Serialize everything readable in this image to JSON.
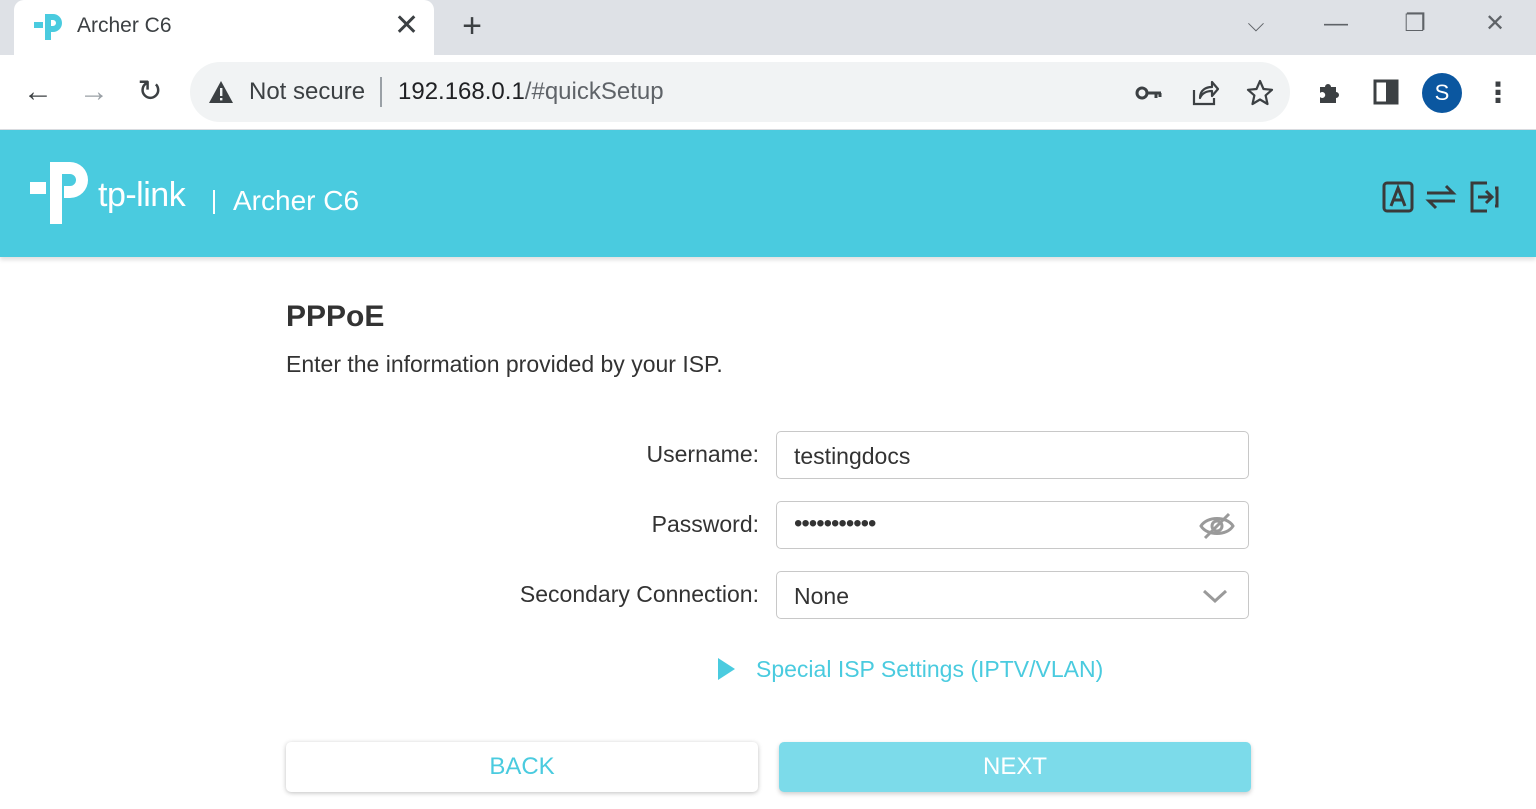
{
  "browser": {
    "tab_title": "Archer C6",
    "tab_close": "✕",
    "new_tab": "+",
    "window_controls": {
      "tab_search": "⌵",
      "minimize": "—",
      "restore": "❐",
      "close": "✕"
    },
    "nav": {
      "back": "←",
      "forward": "→",
      "reload": "↻"
    },
    "omnibox": {
      "security_label": "Not secure",
      "url_host": "192.168.0.1",
      "url_path": "/#quickSetup"
    },
    "profile_initial": "S",
    "menu": "⋮",
    "icons": [
      "warning-icon",
      "key-icon",
      "share-icon",
      "star-icon",
      "extensions-icon",
      "side-panel-icon"
    ]
  },
  "header": {
    "brand": "tp-link",
    "model": "Archer C6",
    "icons": [
      "language-icon",
      "switch-mode-icon",
      "logout-icon"
    ],
    "color": "#4acbdf"
  },
  "form": {
    "title": "PPPoE",
    "subtitle": "Enter the information provided by your ISP.",
    "username": {
      "label": "Username:",
      "value": "testingdocs"
    },
    "password": {
      "label": "Password:",
      "value": "•••••••••••"
    },
    "secondary": {
      "label": "Secondary Connection:",
      "value": "None"
    },
    "special_isp_link": "Special ISP Settings (IPTV/VLAN)",
    "back_label": "BACK",
    "next_label": "NEXT"
  },
  "colors": {
    "accent": "#4acbdf",
    "next_button": "#7cdbea",
    "profile": "#0b57a0"
  }
}
